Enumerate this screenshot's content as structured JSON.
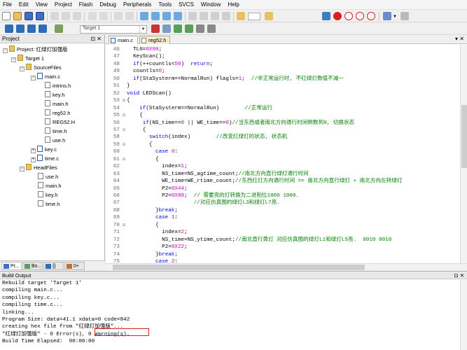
{
  "menu": [
    "File",
    "Edit",
    "View",
    "Project",
    "Flash",
    "Debug",
    "Peripherals",
    "Tools",
    "SVCS",
    "Window",
    "Help"
  ],
  "toolbar": {
    "target": "Target 1"
  },
  "project_panel": {
    "title": "Project",
    "root": "Project: 红绿灯加强版",
    "target": "Target 1",
    "groups": [
      {
        "name": "SourceFiles",
        "files": [
          {
            "name": "main.c",
            "children": [
              "intrins.h",
              "key.h",
              "main.h",
              "reg52.h",
              "REG52.H",
              "time.h",
              "use.h"
            ]
          },
          {
            "name": "key.c"
          },
          {
            "name": "time.c"
          }
        ]
      },
      {
        "name": "HeadFiles",
        "files": [
          {
            "name": "use.h"
          },
          {
            "name": "main.h"
          },
          {
            "name": "key.h"
          },
          {
            "name": "time.h"
          }
        ]
      }
    ],
    "tabs": [
      "Pr...",
      "Bo...",
      "{} Fu...",
      "0+ Te..."
    ]
  },
  "editor": {
    "tabs": [
      "main.c",
      "reg52.h"
    ],
    "lines": [
      {
        "n": "46",
        "t": "  TL0=0X00;"
      },
      {
        "n": "47",
        "t": "  KeyScan();"
      },
      {
        "n": "48",
        "t": "  if(++countls<50)  return;"
      },
      {
        "n": "49",
        "t": "  countls=0;"
      },
      {
        "n": "50",
        "t": "  if(StaSysterm==NormalRun) flagls=1;  //非正常运行时, 不红绿灯数值不减一"
      },
      {
        "n": "51",
        "t": "}"
      },
      {
        "n": "52",
        "t": "void LEDScan()"
      },
      {
        "n": "53",
        "t": "{"
      },
      {
        "n": "54",
        "t": "    if(StaSysterm==NormalRun)        //正常运行"
      },
      {
        "n": "55",
        "t": "    {"
      },
      {
        "n": "56",
        "t": "     if(NS_time==0 || WE_time==0)//当东西或者南北方向通行时间倒数到0, 切换状态"
      },
      {
        "n": "57",
        "t": "     {"
      },
      {
        "n": "58",
        "t": "       switch(index)        //改变红绿灯的状态, 状态机"
      },
      {
        "n": "59",
        "t": "       {"
      },
      {
        "n": "60",
        "t": "         case 0:"
      },
      {
        "n": "61",
        "t": "         {"
      },
      {
        "n": "62",
        "t": "           index=1;"
      },
      {
        "n": "63",
        "t": "           NS_time=NS_agtime_count;//南北方向直行绿灯通行时间"
      },
      {
        "n": "64",
        "t": "           WE_time=WE_rtime_count;//东西红灯方向通行时间 == 南北方向直行绿灯 + 南北方向左转绿灯"
      },
      {
        "n": "65",
        "t": "           P2=0X44;"
      },
      {
        "n": "66",
        "t": "           P2=0X88;  // 需要亮的灯转换为二进制位1000 1000."
      },
      {
        "n": "67",
        "t": "                     //对应仿真图的绿灯L3和绿灯L7亮."
      },
      {
        "n": "68",
        "t": "         }break;"
      },
      {
        "n": "69",
        "t": "         case 1:"
      },
      {
        "n": "70",
        "t": "         {"
      },
      {
        "n": "71",
        "t": "           index=2;"
      },
      {
        "n": "72",
        "t": "           NS_time=NS_ytime_count;//南北直行黄灯 对应仿真图的绿灯L1和绿灯L5亮.  0010 0010"
      },
      {
        "n": "73",
        "t": "           P2=0X22;"
      },
      {
        "n": "74",
        "t": "         }break;"
      },
      {
        "n": "75",
        "t": "         case 2:"
      }
    ]
  },
  "build_output": {
    "title": "Build Output",
    "lines": [
      "Rebuild target 'Target 1'",
      "compiling main.c...",
      "compiling key.c...",
      "compiling time.c...",
      "linking...",
      "Program Size: data=41.1 xdata=0 code=842",
      "creating hex file from \"红绿灯加强版\"...",
      "\"红绿灯加强版\" - 0 Error(s), 0 Warning(s).",
      "Build Time Elapsed:  00:00:00"
    ]
  }
}
